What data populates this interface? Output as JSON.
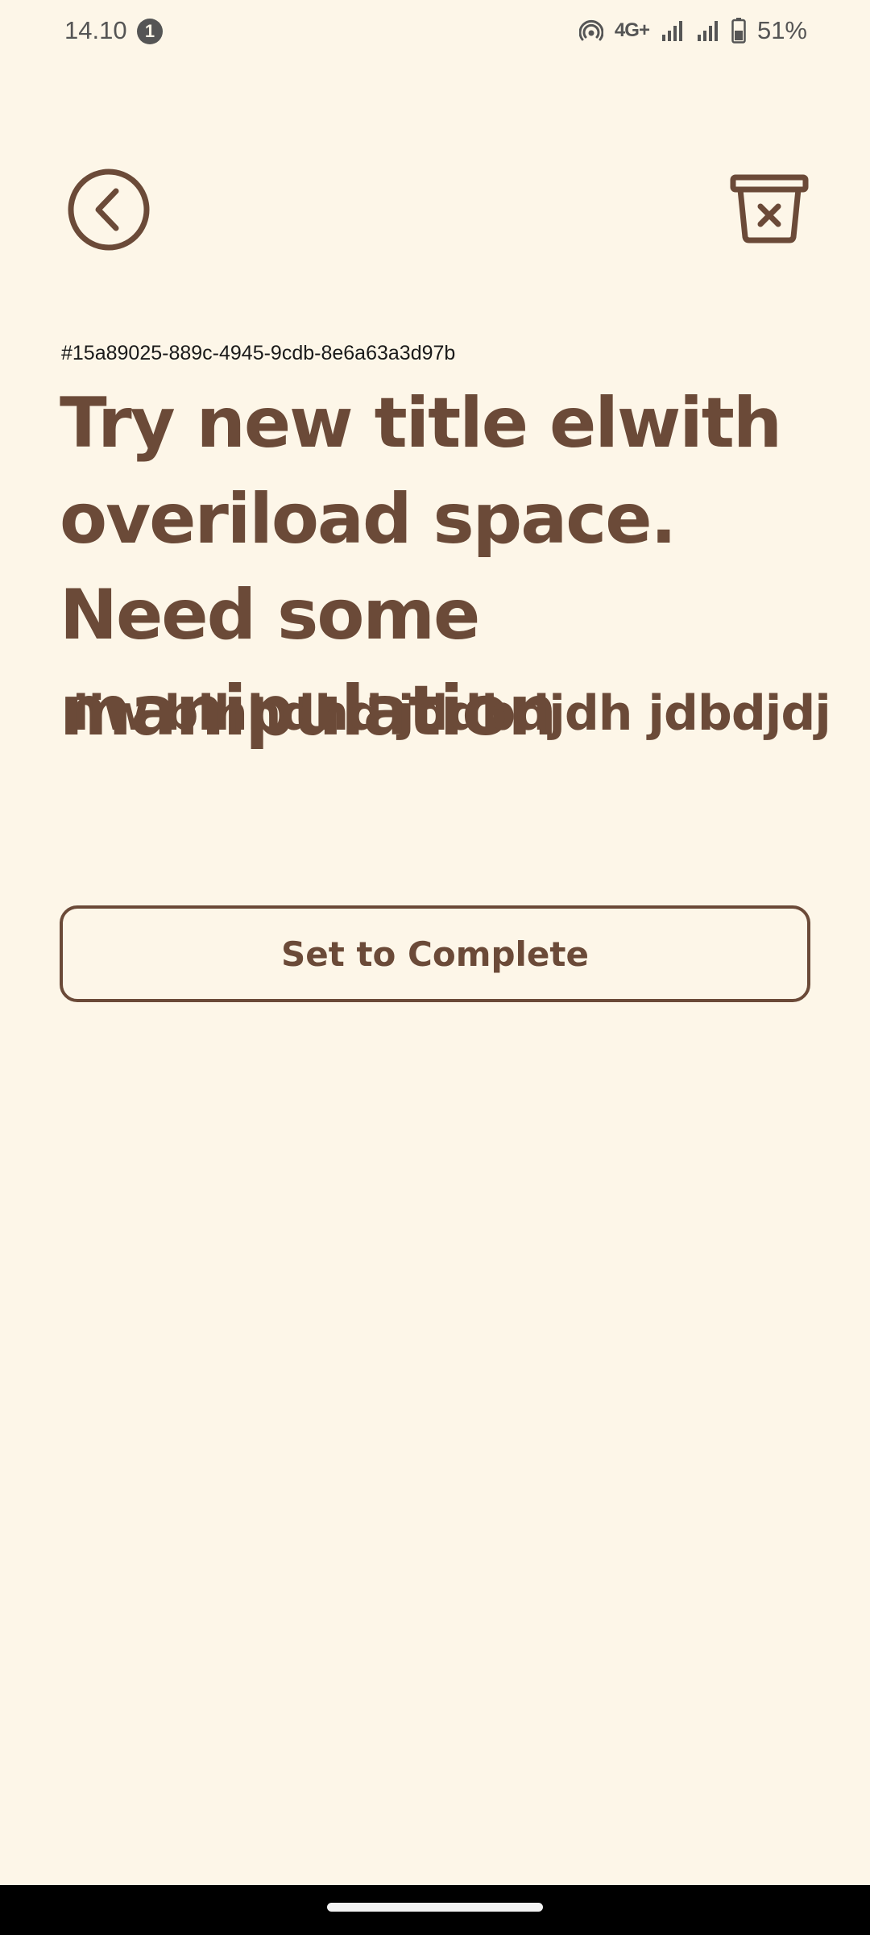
{
  "status_bar": {
    "time": "14.10",
    "notification_count": "1",
    "network": "4G+",
    "battery": "51%"
  },
  "task": {
    "id": "#15a89025-889c-4945-9cdb-8e6a63a3d97b",
    "title": "Try new title elwith overiload space. Need some manipulation",
    "description": "iiw bihhdhd jddbdjdh jdbdjdj"
  },
  "actions": {
    "complete_label": "Set to Complete"
  },
  "icons": {
    "back": "chevron-left-circle-icon",
    "delete": "trash-x-icon"
  },
  "colors": {
    "background": "#fdf6e8",
    "accent": "#6b4a38",
    "status_text": "#555555"
  }
}
